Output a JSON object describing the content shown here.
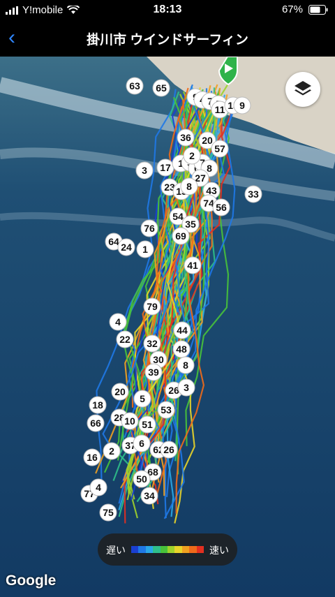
{
  "status": {
    "carrier": "Y!mobile",
    "time": "18:13",
    "battery": "67%"
  },
  "nav": {
    "back_icon": "chevron-left-icon",
    "title": "掛川市 ウインドサーフィン"
  },
  "map": {
    "legend": {
      "slow": "遅い",
      "fast": "速い",
      "colors": [
        "#1a3fd1",
        "#1f78e6",
        "#2aa7e8",
        "#2fbf8a",
        "#48c23a",
        "#9fd22b",
        "#e8d42a",
        "#f0a020",
        "#ef6a1a",
        "#e33020"
      ]
    },
    "attribution": "Google",
    "layers_icon": "layers-icon",
    "start_icon": "play-icon",
    "lap_markers": [
      "63",
      "65",
      "9",
      "4",
      "7",
      "5",
      "11",
      "15",
      "9",
      "36",
      "20",
      "57",
      "3",
      "17",
      "1",
      "5",
      "6",
      "7",
      "8",
      "2",
      "23",
      "15",
      "43",
      "27",
      "33",
      "8",
      "74",
      "56",
      "54",
      "35",
      "76",
      "64",
      "24",
      "69",
      "1",
      "41",
      "79",
      "4",
      "44",
      "22",
      "32",
      "48",
      "30",
      "39",
      "8",
      "20",
      "26",
      "3",
      "5",
      "18",
      "28",
      "10",
      "53",
      "66",
      "51",
      "2",
      "37",
      "6",
      "62",
      "26",
      "16",
      "68",
      "50",
      "77",
      "4",
      "34",
      "75"
    ]
  }
}
